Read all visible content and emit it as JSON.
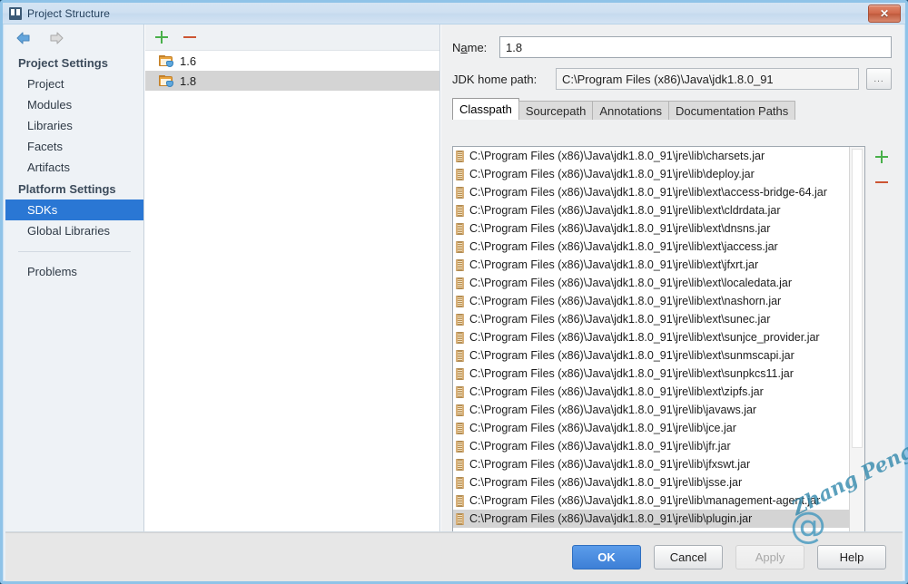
{
  "window": {
    "title": "Project Structure",
    "title_icon": "project-structure-icon",
    "close_label": "✕"
  },
  "nav": {
    "back_icon": "arrow-back-icon",
    "forward_icon": "arrow-forward-icon",
    "groups": [
      {
        "title": "Project Settings",
        "items": [
          "Project",
          "Modules",
          "Libraries",
          "Facets",
          "Artifacts"
        ]
      },
      {
        "title": "Platform Settings",
        "items": [
          "SDKs",
          "Global Libraries"
        ]
      }
    ],
    "selected": "SDKs",
    "problems_label": "Problems"
  },
  "sdk_panel": {
    "add_icon": "plus-icon",
    "remove_icon": "minus-icon",
    "items": [
      "1.6",
      "1.8"
    ],
    "selected": "1.8"
  },
  "details": {
    "name_label": "Name:",
    "name_value": "1.8",
    "jdk_label": "JDK home path:",
    "jdk_value": "C:\\Program Files (x86)\\Java\\jdk1.8.0_91",
    "browse_label": "...",
    "tabs": [
      {
        "label": "Classpath",
        "active": true
      },
      {
        "label": "Sourcepath",
        "active": false
      },
      {
        "label": "Annotations",
        "active": false
      },
      {
        "label": "Documentation Paths",
        "active": false
      }
    ],
    "list_add_icon": "plus-icon",
    "list_remove_icon": "minus-icon",
    "classpath": [
      "C:\\Program Files (x86)\\Java\\jdk1.8.0_91\\jre\\lib\\charsets.jar",
      "C:\\Program Files (x86)\\Java\\jdk1.8.0_91\\jre\\lib\\deploy.jar",
      "C:\\Program Files (x86)\\Java\\jdk1.8.0_91\\jre\\lib\\ext\\access-bridge-64.jar",
      "C:\\Program Files (x86)\\Java\\jdk1.8.0_91\\jre\\lib\\ext\\cldrdata.jar",
      "C:\\Program Files (x86)\\Java\\jdk1.8.0_91\\jre\\lib\\ext\\dnsns.jar",
      "C:\\Program Files (x86)\\Java\\jdk1.8.0_91\\jre\\lib\\ext\\jaccess.jar",
      "C:\\Program Files (x86)\\Java\\jdk1.8.0_91\\jre\\lib\\ext\\jfxrt.jar",
      "C:\\Program Files (x86)\\Java\\jdk1.8.0_91\\jre\\lib\\ext\\localedata.jar",
      "C:\\Program Files (x86)\\Java\\jdk1.8.0_91\\jre\\lib\\ext\\nashorn.jar",
      "C:\\Program Files (x86)\\Java\\jdk1.8.0_91\\jre\\lib\\ext\\sunec.jar",
      "C:\\Program Files (x86)\\Java\\jdk1.8.0_91\\jre\\lib\\ext\\sunjce_provider.jar",
      "C:\\Program Files (x86)\\Java\\jdk1.8.0_91\\jre\\lib\\ext\\sunmscapi.jar",
      "C:\\Program Files (x86)\\Java\\jdk1.8.0_91\\jre\\lib\\ext\\sunpkcs11.jar",
      "C:\\Program Files (x86)\\Java\\jdk1.8.0_91\\jre\\lib\\ext\\zipfs.jar",
      "C:\\Program Files (x86)\\Java\\jdk1.8.0_91\\jre\\lib\\javaws.jar",
      "C:\\Program Files (x86)\\Java\\jdk1.8.0_91\\jre\\lib\\jce.jar",
      "C:\\Program Files (x86)\\Java\\jdk1.8.0_91\\jre\\lib\\jfr.jar",
      "C:\\Program Files (x86)\\Java\\jdk1.8.0_91\\jre\\lib\\jfxswt.jar",
      "C:\\Program Files (x86)\\Java\\jdk1.8.0_91\\jre\\lib\\jsse.jar",
      "C:\\Program Files (x86)\\Java\\jdk1.8.0_91\\jre\\lib\\management-agent.jar",
      "C:\\Program Files (x86)\\Java\\jdk1.8.0_91\\jre\\lib\\plugin.jar"
    ],
    "classpath_selected_index": 20
  },
  "buttons": {
    "ok": "OK",
    "cancel": "Cancel",
    "apply": "Apply",
    "help": "Help"
  },
  "watermark": {
    "text": "Zhang Peng",
    "at_symbol": "@"
  },
  "colors": {
    "accent": "#2a77d4",
    "primary_button": "#3d7fd6",
    "add_icon": "#49b04a",
    "remove_icon": "#cc5533",
    "window_border": "#8fc3e8"
  }
}
